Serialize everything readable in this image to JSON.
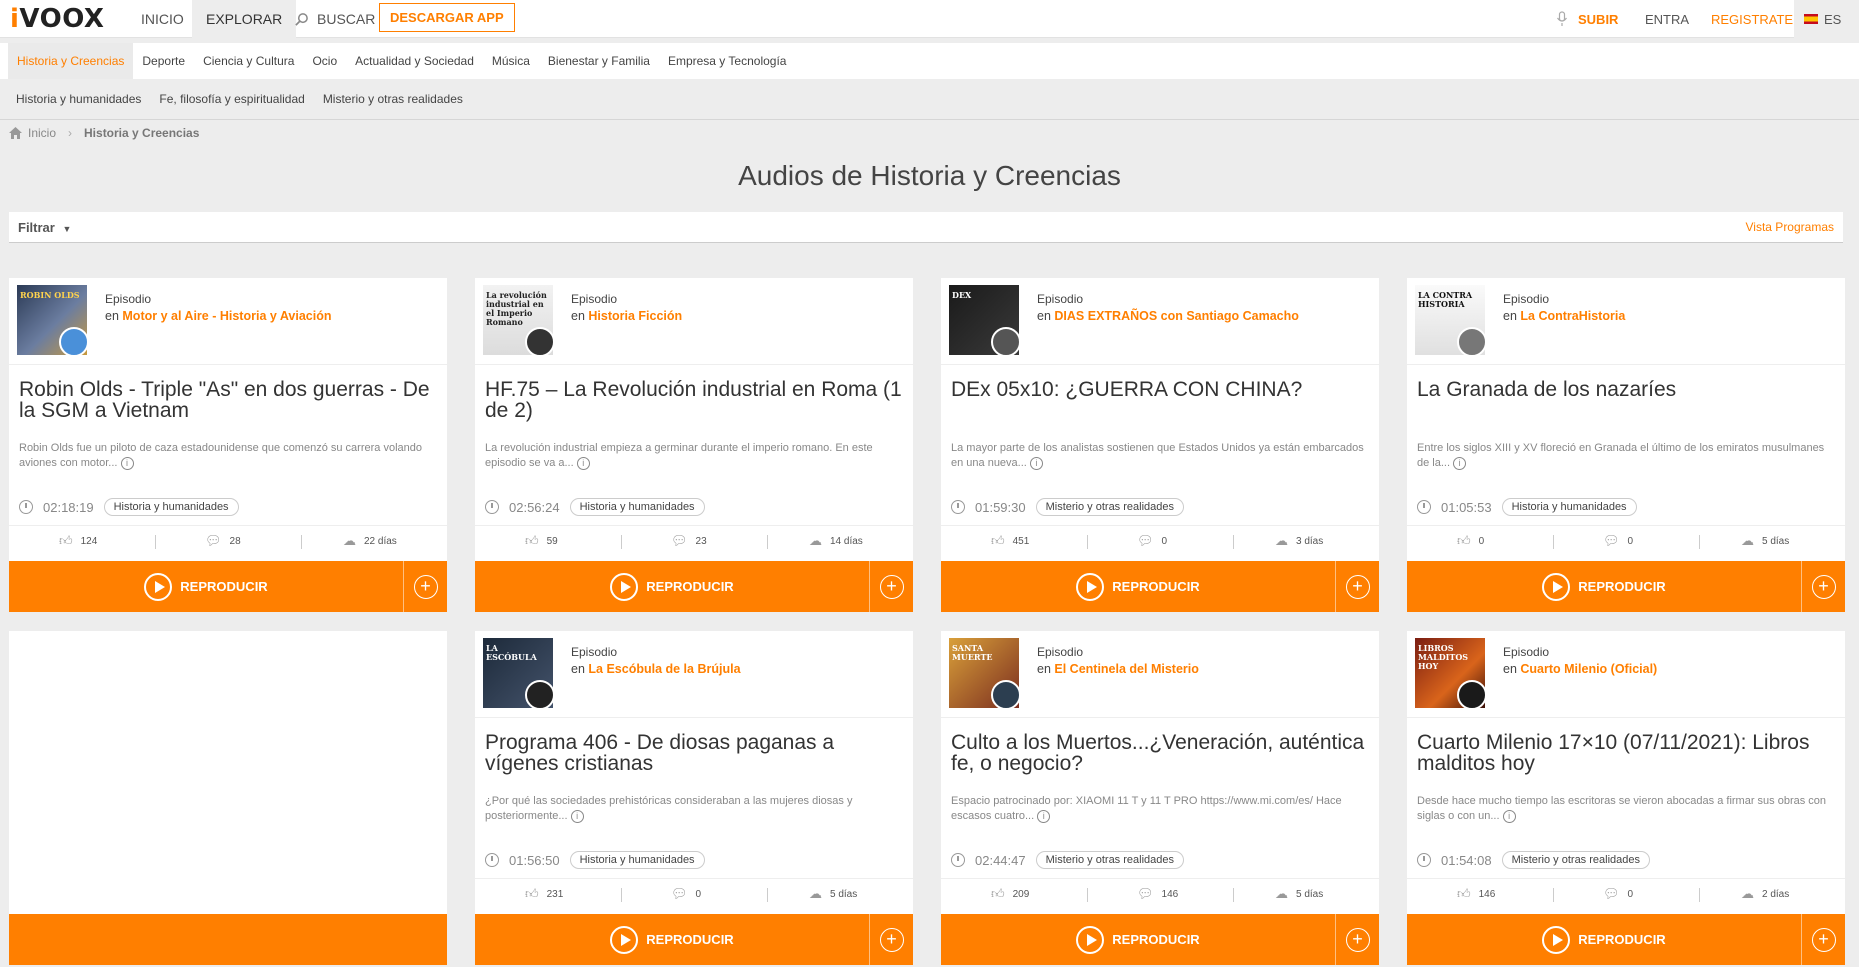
{
  "header": {
    "logo": "VOOX",
    "logo_i": "i",
    "nav": [
      "INICIO",
      "EXPLORAR",
      "BUSCAR"
    ],
    "download_app": "DESCARGAR APP",
    "upload": "SUBIR",
    "login": "ENTRA",
    "register": "REGISTRATE",
    "language": "ES"
  },
  "categories": [
    "Historia y Creencias",
    "Deporte",
    "Ciencia y Cultura",
    "Ocio",
    "Actualidad y Sociedad",
    "Música",
    "Bienestar y Familia",
    "Empresa y Tecnología"
  ],
  "subcategories": [
    "Historia y humanidades",
    "Fe, filosofía y espiritualidad",
    "Misterio y otras realidades"
  ],
  "breadcrumb": {
    "home": "Inicio",
    "current": "Historia y Creencias"
  },
  "page_title": "Audios de Historia y Creencias",
  "filter": {
    "label": "Filtrar",
    "view": "Vista Programas"
  },
  "play_label": "REPRODUCIR",
  "episodes": [
    {
      "type": "Episodio",
      "in": "en",
      "program": "Motor y al Aire - Historia y Aviación",
      "title": "Robin Olds - Triple \"As\" en dos guerras - De la SGM a Vietnam",
      "desc": "Robin Olds fue un piloto de caza estadounidense que comenzó su carrera volando aviones con motor...",
      "duration": "02:18:19",
      "tag": "Historia y humanidades",
      "likes": "124",
      "comments": "28",
      "date": "22 días",
      "thumb_text": "ROBIN OLDS"
    },
    {
      "type": "Episodio",
      "in": "en",
      "program": "Historia Ficción",
      "title": "HF.75 – La Revolución industrial en Roma (1 de 2)",
      "desc": "La revolución industrial empieza a germinar durante el imperio romano. En este episodio se va a...",
      "duration": "02:56:24",
      "tag": "Historia y humanidades",
      "likes": "59",
      "comments": "23",
      "date": "14 días",
      "thumb_text": "La revolución industrial en el Imperio Romano"
    },
    {
      "type": "Episodio",
      "in": "en",
      "program": "DIAS EXTRAÑOS con Santiago Camacho",
      "title": "DEx 05x10: ¿GUERRA CON CHINA?",
      "desc": "La mayor parte de los analistas sostienen que Estados Unidos ya están embarcados en una nueva...",
      "duration": "01:59:30",
      "tag": "Misterio y otras realidades",
      "likes": "451",
      "comments": "0",
      "date": "3 días",
      "thumb_text": "DEX"
    },
    {
      "type": "Episodio",
      "in": "en",
      "program": "La ContraHistoria",
      "title": "La Granada de los nazaríes",
      "desc": "Entre los siglos XIII y XV floreció en Granada el último de los emiratos musulmanes de la...",
      "duration": "01:05:53",
      "tag": "Historia y humanidades",
      "likes": "0",
      "comments": "0",
      "date": "5 días",
      "thumb_text": "LA CONTRA HISTORIA"
    },
    {
      "type": "Episodio",
      "in": "en",
      "program": "La Escóbula de la Brújula",
      "title": "Programa 406 - De diosas paganas a vígenes cristianas",
      "desc": "¿Por qué las sociedades prehistóricas consideraban a las mujeres diosas y posteriormente...",
      "duration": "01:56:50",
      "tag": "Historia y humanidades",
      "likes": "231",
      "comments": "0",
      "date": "5 días",
      "thumb_text": "LA ESCÓBULA"
    },
    {
      "type": "Episodio",
      "in": "en",
      "program": "El Centinela del Misterio",
      "title": "Culto a los Muertos...¿Veneración, auténtica fe, o negocio?",
      "desc": "Espacio patrocinado por: XIAOMI 11 T y 11 T PRO https://www.mi.com/es/ Hace escasos cuatro...",
      "duration": "02:44:47",
      "tag": "Misterio y otras realidades",
      "likes": "209",
      "comments": "146",
      "date": "5 días",
      "thumb_text": "SANTA MUERTE"
    },
    {
      "type": "Episodio",
      "in": "en",
      "program": "Cuarto Milenio (Oficial)",
      "title": "Cuarto Milenio 17×10 (07/11/2021): Libros malditos hoy",
      "desc": "Desde hace mucho tiempo las escritoras se vieron abocadas a firmar sus obras con siglas o con un...",
      "duration": "01:54:08",
      "tag": "Misterio y otras realidades",
      "likes": "146",
      "comments": "0",
      "date": "2 días",
      "thumb_text": "LIBROS MALDITOS HOY"
    }
  ],
  "colors": {
    "accent": "#ff7f00",
    "background": "#ededed"
  }
}
